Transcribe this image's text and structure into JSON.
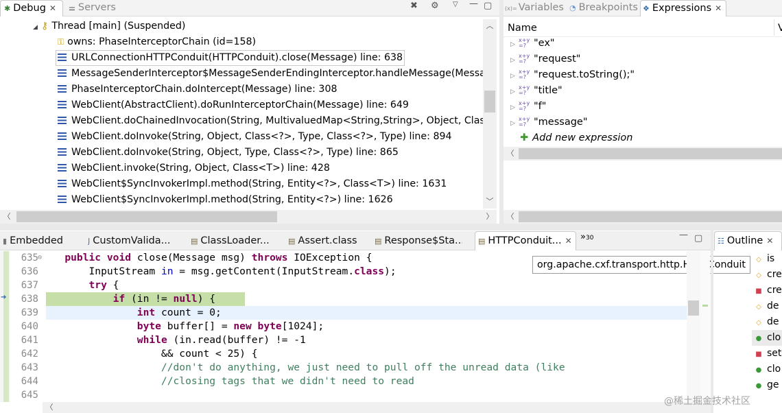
{
  "debug_view": {
    "tabs": [
      {
        "label": "Debug",
        "active": true
      },
      {
        "label": "Servers",
        "active": false
      }
    ],
    "thread": "Thread [main] (Suspended)",
    "owns": "owns: PhaseInterceptorChain  (id=158)",
    "frames": [
      "URLConnectionHTTPConduit(HTTPConduit).close(Message) line: 638",
      "MessageSenderInterceptor$MessageSenderEndingInterceptor.handleMessage(Message) lin",
      "PhaseInterceptorChain.doIntercept(Message) line: 308",
      "WebClient(AbstractClient).doRunInterceptorChain(Message) line: 649",
      "WebClient.doChainedInvocation(String, MultivaluedMap<String,String>, Object, Class<?>, T",
      "WebClient.doInvoke(String, Object, Class<?>, Type, Class<?>, Type) line: 894",
      "WebClient.doInvoke(String, Object, Type, Class<?>, Type) line: 865",
      "WebClient.invoke(String, Object, Class<T>) line: 428",
      "WebClient$SyncInvokerImpl.method(String, Entity<?>, Class<T>) line: 1631",
      "WebClient$SyncInvokerImpl.method(String, Entity<?>) line: 1626"
    ]
  },
  "expressions_view": {
    "tabs": [
      {
        "label": "Variables",
        "prefix": "(x)=",
        "active": false
      },
      {
        "label": "Breakpoints",
        "active": false
      },
      {
        "label": "Expressions",
        "active": true
      }
    ],
    "column_name": "Name",
    "column_value": "V",
    "items": [
      "\"ex\"",
      "\"request\"",
      "\"request.toString();\"",
      "\"title\"",
      "\"f\"",
      "\"message\""
    ],
    "xy_icon": "x+y\n=?",
    "add_new": "Add new expression"
  },
  "editor": {
    "tabs": [
      {
        "label": "Embedded",
        "active": false
      },
      {
        "label": "CustomValida...",
        "active": false
      },
      {
        "label": "ClassLoader...",
        "active": false
      },
      {
        "label": "Assert.class",
        "active": false
      },
      {
        "label": "Response$Sta...",
        "active": false
      },
      {
        "label": "HTTPConduit...",
        "active": true
      }
    ],
    "overflow_marker": "»",
    "overflow_count": "30",
    "tooltip": "org.apache.cxf.transport.http.HTTPConduit",
    "line_numbers": [
      "635",
      "636",
      "637",
      "638",
      "639",
      "640",
      "641",
      "642",
      "643",
      "644",
      "645"
    ],
    "current_line": "638",
    "highlight_colors": {
      "current": "#c6dfa8",
      "cursor": "#e8f2fe"
    }
  },
  "outline_view": {
    "title": "Outline",
    "items": [
      "is",
      "cre",
      "cre",
      "de",
      "de",
      "clo",
      "set",
      "clo",
      "ge"
    ]
  },
  "watermark": "@稀土掘金技术社区"
}
